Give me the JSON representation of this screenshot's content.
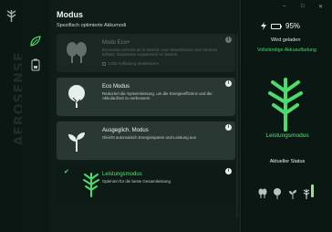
{
  "brand": {
    "vertical_text": "AEROSENSE"
  },
  "window_controls": {
    "minimize": "–",
    "maximize": "□",
    "close": "✕"
  },
  "page": {
    "title": "Modus",
    "subtitle": "Spezifisch optimierte Akkumodi"
  },
  "modes": [
    {
      "name": "Modo Eco+",
      "description": "Economia extrema de la bateria: evar desactivacion des fomento tellidas. Dispositivo seguiement en bateria.",
      "usb_label": "USB-Aufladung deaktivieren",
      "state": "disabled",
      "icon": "trees-icon"
    },
    {
      "name": "Eco Modus",
      "description": "Reduziert die Systemleistung, um die Energieeffizienz und die Akkulaufzeit zu verbessern",
      "state": "normal",
      "icon": "tree-icon"
    },
    {
      "name": "Ausgeglich. Modus",
      "description": "Gleicht automatisch Energiesparen und Leistung aus",
      "state": "normal",
      "icon": "sprout-icon"
    },
    {
      "name": "Leistungsmodus",
      "description": "Optimiert für die beste Gesamtleistung",
      "state": "active",
      "icon": "branch-icon"
    }
  ],
  "info_glyph": "i",
  "check_glyph": "✔",
  "status": {
    "battery_percent": "95%",
    "charging_text": "Wird geladen",
    "full_charge_link": "Vollständige Akkuaufladung",
    "current_mode_name": "Leistungsmodus",
    "current_status_label": "Aktueller Status"
  },
  "colors": {
    "accent": "#4ddb6c",
    "active_card": "#0d1a16",
    "card": "#2a3834",
    "background": "#08120f"
  }
}
